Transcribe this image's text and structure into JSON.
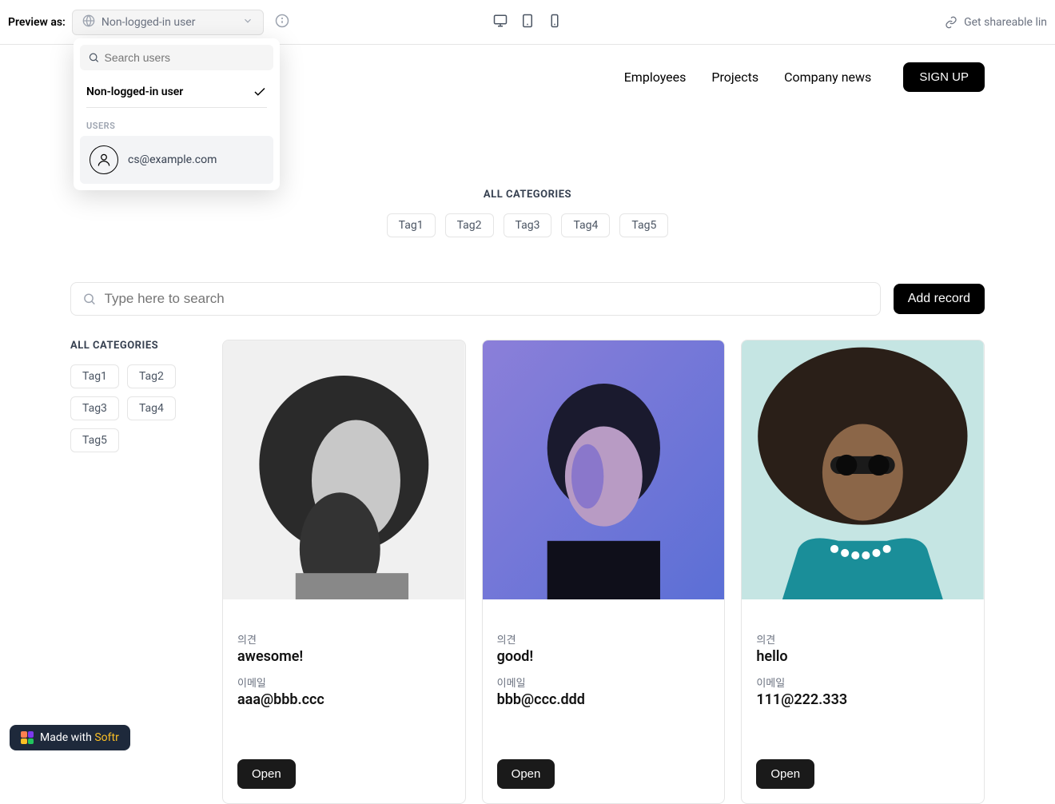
{
  "topbar": {
    "previewLabel": "Preview as:",
    "previewValue": "Non-logged-in user",
    "shareText": "Get shareable lin"
  },
  "dropdown": {
    "searchPlaceholder": "Search users",
    "selectedLabel": "Non-logged-in user",
    "usersHeading": "USERS",
    "userEmail": "cs@example.com"
  },
  "nav": {
    "links": [
      "Employees",
      "Projects",
      "Company news"
    ],
    "signup": "SIGN UP"
  },
  "categories": {
    "title": "ALL CATEGORIES",
    "tags": [
      "Tag1",
      "Tag2",
      "Tag3",
      "Tag4",
      "Tag5"
    ]
  },
  "search": {
    "placeholder": "Type here to search",
    "addRecord": "Add record"
  },
  "sidebar": {
    "title": "ALL CATEGORIES",
    "tags": [
      "Tag1",
      "Tag2",
      "Tag3",
      "Tag4",
      "Tag5"
    ]
  },
  "cards": [
    {
      "opinionLabel": "의견",
      "opinion": "awesome!",
      "emailLabel": "이메일",
      "email": "aaa@bbb.ccc",
      "open": "Open"
    },
    {
      "opinionLabel": "의견",
      "opinion": "good!",
      "emailLabel": "이메일",
      "email": "bbb@ccc.ddd",
      "open": "Open"
    },
    {
      "opinionLabel": "의견",
      "opinion": "hello",
      "emailLabel": "이메일",
      "email": "111@222.333",
      "open": "Open"
    }
  ],
  "footer": {
    "madeWith": "Made with ",
    "brand": "Softr"
  }
}
